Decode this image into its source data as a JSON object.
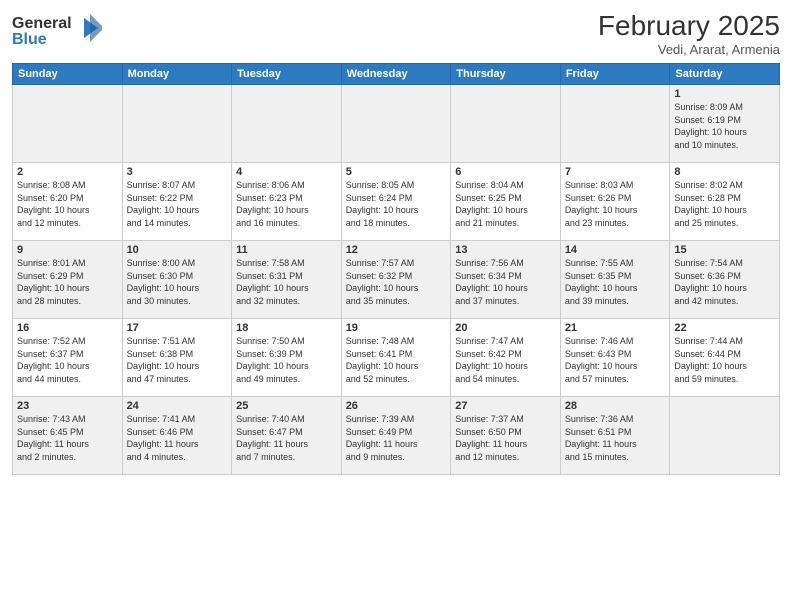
{
  "logo": {
    "line1": "General",
    "line2": "Blue",
    "icon": "▶"
  },
  "title": "February 2025",
  "location": "Vedi, Ararat, Armenia",
  "days_of_week": [
    "Sunday",
    "Monday",
    "Tuesday",
    "Wednesday",
    "Thursday",
    "Friday",
    "Saturday"
  ],
  "weeks": [
    [
      {
        "day": "",
        "info": ""
      },
      {
        "day": "",
        "info": ""
      },
      {
        "day": "",
        "info": ""
      },
      {
        "day": "",
        "info": ""
      },
      {
        "day": "",
        "info": ""
      },
      {
        "day": "",
        "info": ""
      },
      {
        "day": "1",
        "info": "Sunrise: 8:09 AM\nSunset: 6:19 PM\nDaylight: 10 hours\nand 10 minutes."
      }
    ],
    [
      {
        "day": "2",
        "info": "Sunrise: 8:08 AM\nSunset: 6:20 PM\nDaylight: 10 hours\nand 12 minutes."
      },
      {
        "day": "3",
        "info": "Sunrise: 8:07 AM\nSunset: 6:22 PM\nDaylight: 10 hours\nand 14 minutes."
      },
      {
        "day": "4",
        "info": "Sunrise: 8:06 AM\nSunset: 6:23 PM\nDaylight: 10 hours\nand 16 minutes."
      },
      {
        "day": "5",
        "info": "Sunrise: 8:05 AM\nSunset: 6:24 PM\nDaylight: 10 hours\nand 18 minutes."
      },
      {
        "day": "6",
        "info": "Sunrise: 8:04 AM\nSunset: 6:25 PM\nDaylight: 10 hours\nand 21 minutes."
      },
      {
        "day": "7",
        "info": "Sunrise: 8:03 AM\nSunset: 6:26 PM\nDaylight: 10 hours\nand 23 minutes."
      },
      {
        "day": "8",
        "info": "Sunrise: 8:02 AM\nSunset: 6:28 PM\nDaylight: 10 hours\nand 25 minutes."
      }
    ],
    [
      {
        "day": "9",
        "info": "Sunrise: 8:01 AM\nSunset: 6:29 PM\nDaylight: 10 hours\nand 28 minutes."
      },
      {
        "day": "10",
        "info": "Sunrise: 8:00 AM\nSunset: 6:30 PM\nDaylight: 10 hours\nand 30 minutes."
      },
      {
        "day": "11",
        "info": "Sunrise: 7:58 AM\nSunset: 6:31 PM\nDaylight: 10 hours\nand 32 minutes."
      },
      {
        "day": "12",
        "info": "Sunrise: 7:57 AM\nSunset: 6:32 PM\nDaylight: 10 hours\nand 35 minutes."
      },
      {
        "day": "13",
        "info": "Sunrise: 7:56 AM\nSunset: 6:34 PM\nDaylight: 10 hours\nand 37 minutes."
      },
      {
        "day": "14",
        "info": "Sunrise: 7:55 AM\nSunset: 6:35 PM\nDaylight: 10 hours\nand 39 minutes."
      },
      {
        "day": "15",
        "info": "Sunrise: 7:54 AM\nSunset: 6:36 PM\nDaylight: 10 hours\nand 42 minutes."
      }
    ],
    [
      {
        "day": "16",
        "info": "Sunrise: 7:52 AM\nSunset: 6:37 PM\nDaylight: 10 hours\nand 44 minutes."
      },
      {
        "day": "17",
        "info": "Sunrise: 7:51 AM\nSunset: 6:38 PM\nDaylight: 10 hours\nand 47 minutes."
      },
      {
        "day": "18",
        "info": "Sunrise: 7:50 AM\nSunset: 6:39 PM\nDaylight: 10 hours\nand 49 minutes."
      },
      {
        "day": "19",
        "info": "Sunrise: 7:48 AM\nSunset: 6:41 PM\nDaylight: 10 hours\nand 52 minutes."
      },
      {
        "day": "20",
        "info": "Sunrise: 7:47 AM\nSunset: 6:42 PM\nDaylight: 10 hours\nand 54 minutes."
      },
      {
        "day": "21",
        "info": "Sunrise: 7:46 AM\nSunset: 6:43 PM\nDaylight: 10 hours\nand 57 minutes."
      },
      {
        "day": "22",
        "info": "Sunrise: 7:44 AM\nSunset: 6:44 PM\nDaylight: 10 hours\nand 59 minutes."
      }
    ],
    [
      {
        "day": "23",
        "info": "Sunrise: 7:43 AM\nSunset: 6:45 PM\nDaylight: 11 hours\nand 2 minutes."
      },
      {
        "day": "24",
        "info": "Sunrise: 7:41 AM\nSunset: 6:46 PM\nDaylight: 11 hours\nand 4 minutes."
      },
      {
        "day": "25",
        "info": "Sunrise: 7:40 AM\nSunset: 6:47 PM\nDaylight: 11 hours\nand 7 minutes."
      },
      {
        "day": "26",
        "info": "Sunrise: 7:39 AM\nSunset: 6:49 PM\nDaylight: 11 hours\nand 9 minutes."
      },
      {
        "day": "27",
        "info": "Sunrise: 7:37 AM\nSunset: 6:50 PM\nDaylight: 11 hours\nand 12 minutes."
      },
      {
        "day": "28",
        "info": "Sunrise: 7:36 AM\nSunset: 6:51 PM\nDaylight: 11 hours\nand 15 minutes."
      },
      {
        "day": "",
        "info": ""
      }
    ]
  ]
}
